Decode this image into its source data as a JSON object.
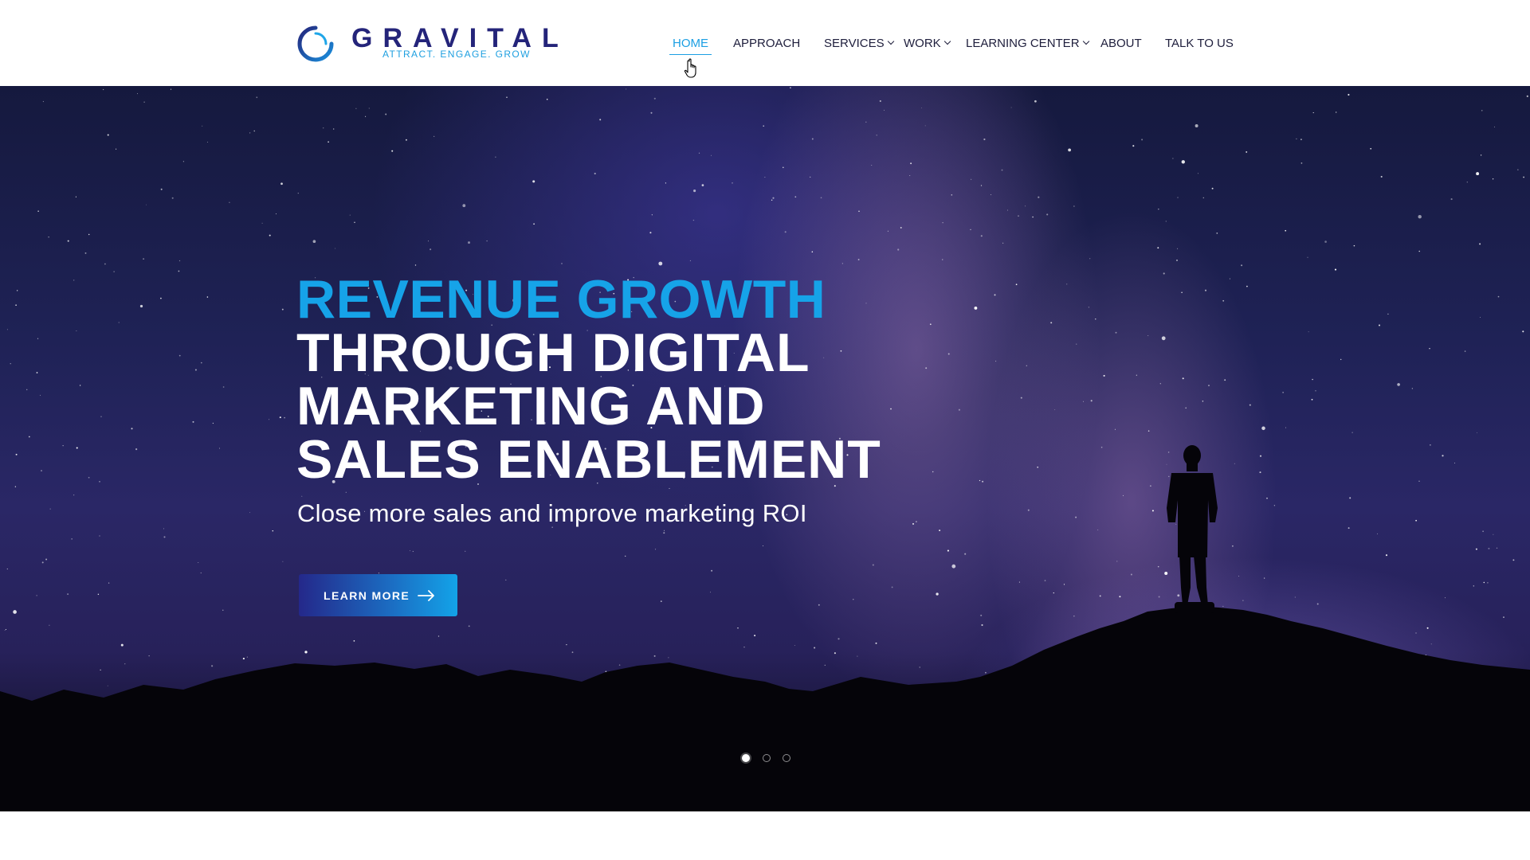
{
  "brand": {
    "name": "GRAVITAL",
    "tagline": "ATTRACT. ENGAGE. GROW",
    "colors": {
      "primary_blue": "#16a3e8",
      "navy": "#24247a"
    }
  },
  "nav": {
    "items": [
      {
        "label": "HOME",
        "active": true,
        "has_dropdown": false
      },
      {
        "label": "APPROACH",
        "active": false,
        "has_dropdown": false
      },
      {
        "label": "SERVICES",
        "active": false,
        "has_dropdown": true
      },
      {
        "label": "WORK",
        "active": false,
        "has_dropdown": true
      },
      {
        "label": "LEARNING CENTER",
        "active": false,
        "has_dropdown": true
      },
      {
        "label": "ABOUT",
        "active": false,
        "has_dropdown": false
      },
      {
        "label": "TALK TO US",
        "active": false,
        "has_dropdown": false
      }
    ]
  },
  "hero": {
    "headline_highlight": "REVENUE GROWTH",
    "headline_line2": "THROUGH DIGITAL",
    "headline_line3": "MARKETING AND",
    "headline_line4": "SALES ENABLEMENT",
    "subheadline": "Close more sales and improve marketing ROI",
    "cta_label": "LEARN MORE",
    "cta_icon": "arrow-right-icon",
    "slider": {
      "count": 3,
      "active_index": 0
    }
  },
  "cursor": {
    "icon": "hand-pointer-icon"
  }
}
